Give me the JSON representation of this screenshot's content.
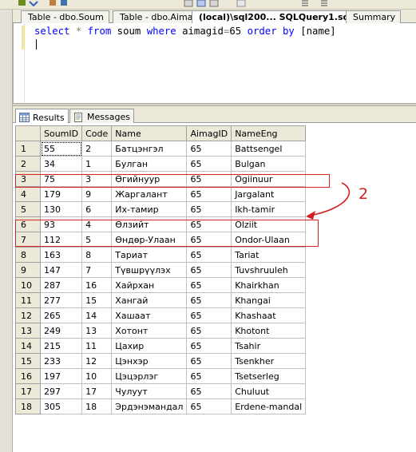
{
  "tabs": [
    {
      "label": "Table - dbo.Soum",
      "active": false
    },
    {
      "label": "Table - dbo.Aimag",
      "active": false
    },
    {
      "label": "(local)\\sql200... SQLQuery1.sql*",
      "active": true
    },
    {
      "label": "Summary",
      "active": false
    }
  ],
  "editor": {
    "tokens": [
      {
        "text": "select",
        "kind": "kw"
      },
      {
        "text": " * ",
        "kind": "op"
      },
      {
        "text": "from",
        "kind": "kw"
      },
      {
        "text": " soum ",
        "kind": "tx"
      },
      {
        "text": "where",
        "kind": "kw"
      },
      {
        "text": " aimagid",
        "kind": "tx"
      },
      {
        "text": "=",
        "kind": "op"
      },
      {
        "text": "65 ",
        "kind": "tx"
      },
      {
        "text": "order",
        "kind": "kw"
      },
      {
        "text": " ",
        "kind": "tx"
      },
      {
        "text": "by",
        "kind": "kw"
      },
      {
        "text": " [name]",
        "kind": "tx"
      }
    ]
  },
  "result_tabs": {
    "results": "Results",
    "messages": "Messages"
  },
  "grid": {
    "columns": [
      "SoumID",
      "Code",
      "Name",
      "AimagID",
      "NameEng"
    ],
    "rows": [
      [
        "1",
        "55",
        "2",
        "Батцэнгэл",
        "65",
        "Battsengel"
      ],
      [
        "2",
        "34",
        "1",
        "Булган",
        "65",
        "Bulgan"
      ],
      [
        "3",
        "75",
        "3",
        "Өгийнуур",
        "65",
        "Ogiinuur"
      ],
      [
        "4",
        "179",
        "9",
        "Жаргалант",
        "65",
        "Jargalant"
      ],
      [
        "5",
        "130",
        "6",
        "Их-тамир",
        "65",
        "Ikh-tamir"
      ],
      [
        "6",
        "93",
        "4",
        "Өлзийт",
        "65",
        "Olziit"
      ],
      [
        "7",
        "112",
        "5",
        "Өндөр-Улаан",
        "65",
        "Ondor-Ulaan"
      ],
      [
        "8",
        "163",
        "8",
        "Тариат",
        "65",
        "Tariat"
      ],
      [
        "9",
        "147",
        "7",
        "Түвшрүүлэх",
        "65",
        "Tuvshruuleh"
      ],
      [
        "10",
        "287",
        "16",
        "Хайрхан",
        "65",
        "Khairkhan"
      ],
      [
        "11",
        "277",
        "15",
        "Хангай",
        "65",
        "Khangai"
      ],
      [
        "12",
        "265",
        "14",
        "Хашаат",
        "65",
        "Khashaat"
      ],
      [
        "13",
        "249",
        "13",
        "Хотонт",
        "65",
        "Khotont"
      ],
      [
        "14",
        "215",
        "11",
        "Цахир",
        "65",
        "Tsahir"
      ],
      [
        "15",
        "233",
        "12",
        "Цэнхэр",
        "65",
        "Tsenkher"
      ],
      [
        "16",
        "197",
        "10",
        "Цэцэрлэг",
        "65",
        "Tsetserleg"
      ],
      [
        "17",
        "297",
        "17",
        "Чулуут",
        "65",
        "Chuluut"
      ],
      [
        "18",
        "305",
        "18",
        "Эрдэнэмандал",
        "65",
        "Erdene-mandal"
      ]
    ]
  },
  "annotation": {
    "label": "2",
    "color": "#d42020",
    "highlighted_rows": [
      "3",
      "6",
      "7"
    ]
  },
  "colors": {
    "keyword": "#0000ff",
    "operator": "#808080",
    "chrome": "#ece9d8"
  }
}
